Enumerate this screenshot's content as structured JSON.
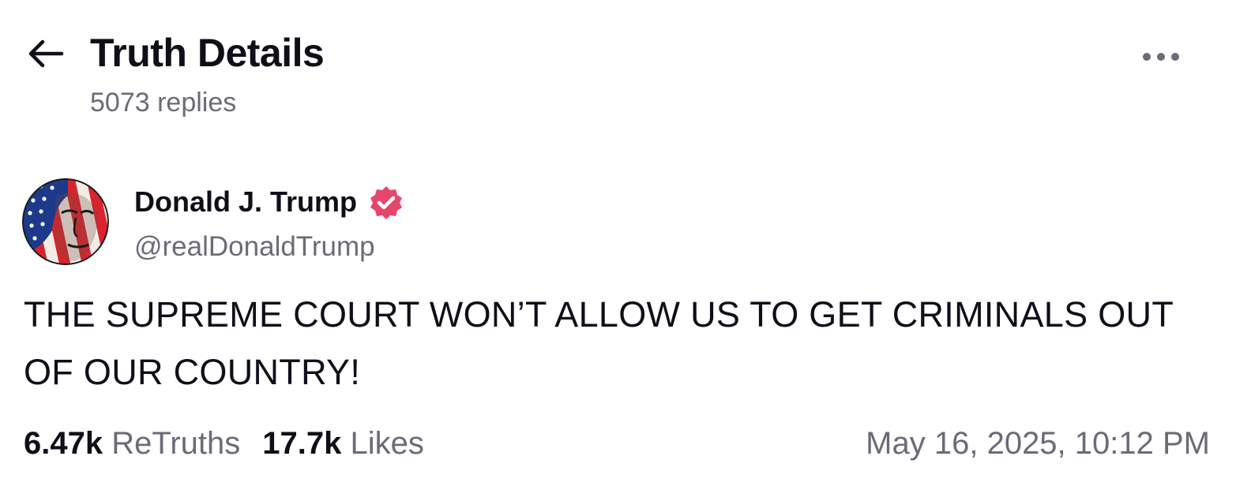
{
  "header": {
    "title": "Truth Details",
    "reply_count": "5073 replies",
    "back_icon": "arrow-left-icon",
    "more_icon": "ellipsis-icon"
  },
  "post": {
    "author": {
      "name": "Donald J. Trump",
      "handle": "@realDonaldTrump",
      "verified": true,
      "badge_color": "#e7466c"
    },
    "text": "THE SUPREME COURT WON’T ALLOW US TO GET CRIMINALS OUT OF OUR COUNTRY!",
    "stats": {
      "retruths_count": "6.47k",
      "retruths_label": "ReTruths",
      "likes_count": "17.7k",
      "likes_label": "Likes"
    },
    "timestamp": "May 16, 2025, 10:12 PM"
  },
  "colors": {
    "text_primary": "#0f0f1a",
    "text_secondary": "#6b6b78",
    "accent": "#e7466c",
    "background": "#ffffff"
  }
}
